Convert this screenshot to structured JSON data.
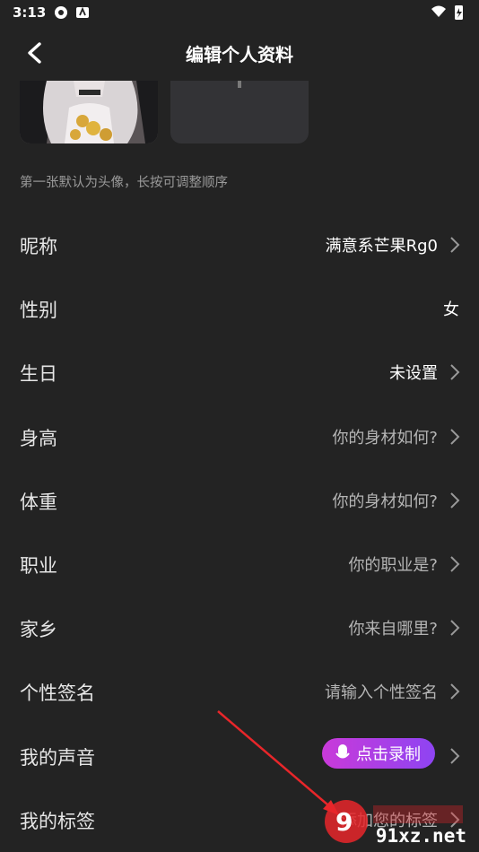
{
  "status_bar": {
    "time": "3:13"
  },
  "header": {
    "title": "编辑个人资料"
  },
  "photos": {
    "hint": "第一张默认为头像，长按可调整顺序"
  },
  "fields": [
    {
      "label": "昵称",
      "value": "满意系芒果Rg0",
      "value_style": "white",
      "chevron": true
    },
    {
      "label": "性别",
      "value": "女",
      "value_style": "white",
      "chevron": false
    },
    {
      "label": "生日",
      "value": "未设置",
      "value_style": "white",
      "chevron": true
    },
    {
      "label": "身高",
      "value": "你的身材如何?",
      "value_style": "gray",
      "chevron": true
    },
    {
      "label": "体重",
      "value": "你的身材如何?",
      "value_style": "gray",
      "chevron": true
    },
    {
      "label": "职业",
      "value": "你的职业是?",
      "value_style": "gray",
      "chevron": true
    },
    {
      "label": "家乡",
      "value": "你来自哪里?",
      "value_style": "gray",
      "chevron": true
    },
    {
      "label": "个性签名",
      "value": "请输入个性签名",
      "value_style": "gray",
      "chevron": true
    },
    {
      "label": "我的声音",
      "button_label": "点击录制",
      "chevron": true
    },
    {
      "label": "我的标签",
      "value": "添加您的标签",
      "value_style": "gray",
      "chevron": true
    }
  ],
  "watermark": {
    "site": "91xz.net"
  },
  "colors": {
    "background": "#232323",
    "record_gradient_start": "#c93ad9",
    "record_gradient_end": "#8e44f2",
    "annotation_arrow": "#e8262a"
  }
}
